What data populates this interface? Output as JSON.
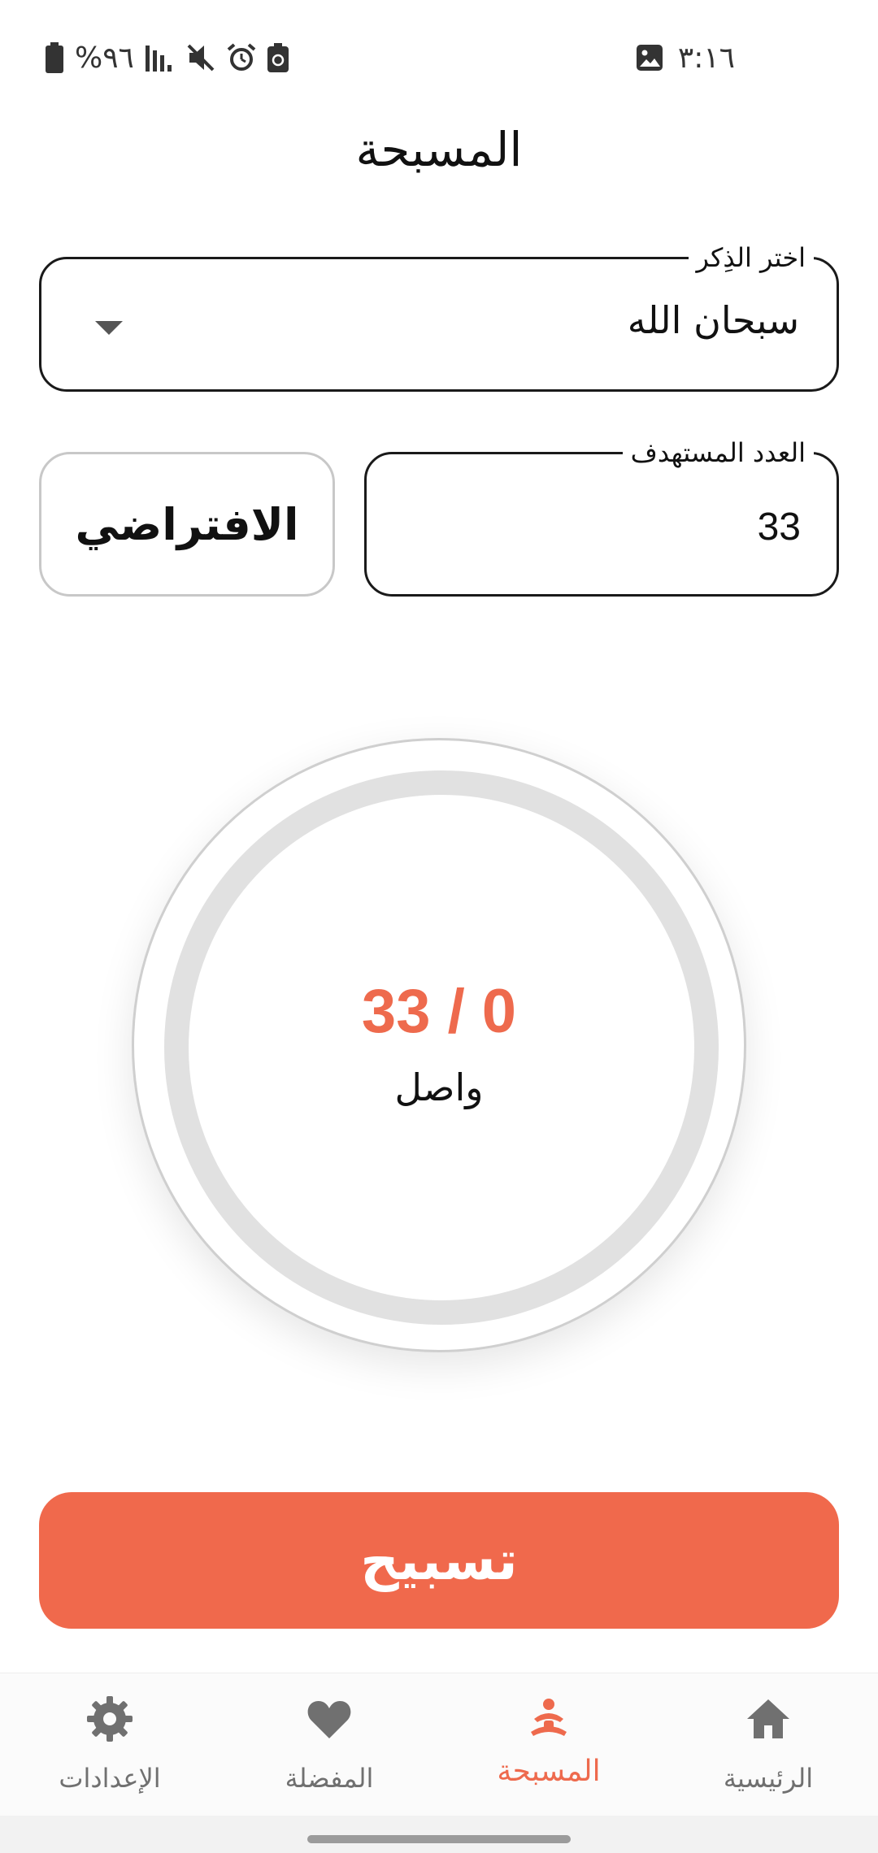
{
  "status_bar": {
    "battery": "%٩٦",
    "time": "٣:١٦",
    "icons": [
      "battery-icon",
      "signal-icon",
      "mute-icon",
      "alarm-icon",
      "battery-saver-icon",
      "gallery-icon"
    ]
  },
  "header": {
    "title": "المسبحة"
  },
  "dhikr_select": {
    "label": "اختر الذِكر",
    "value": "سبحان الله"
  },
  "target_input": {
    "label": "العدد المستهدف",
    "value": "33"
  },
  "default_button": {
    "label": "الافتراضي"
  },
  "counter": {
    "display": "33 / 0",
    "current": 0,
    "target": 33,
    "caption": "واصل"
  },
  "tasbih_button": {
    "label": "تسبيح"
  },
  "bottom_nav": {
    "items": [
      {
        "label": "الرئيسية",
        "icon": "home-icon",
        "active": false
      },
      {
        "label": "المسبحة",
        "icon": "meditation-icon",
        "active": true
      },
      {
        "label": "المفضلة",
        "icon": "heart-icon",
        "active": false
      },
      {
        "label": "الإعدادات",
        "icon": "gear-icon",
        "active": false
      }
    ]
  },
  "colors": {
    "accent": "#f0694c",
    "accent_text": "#ee6a4d",
    "ring_track": "#e1e1e1",
    "inactive_nav": "#707070"
  }
}
